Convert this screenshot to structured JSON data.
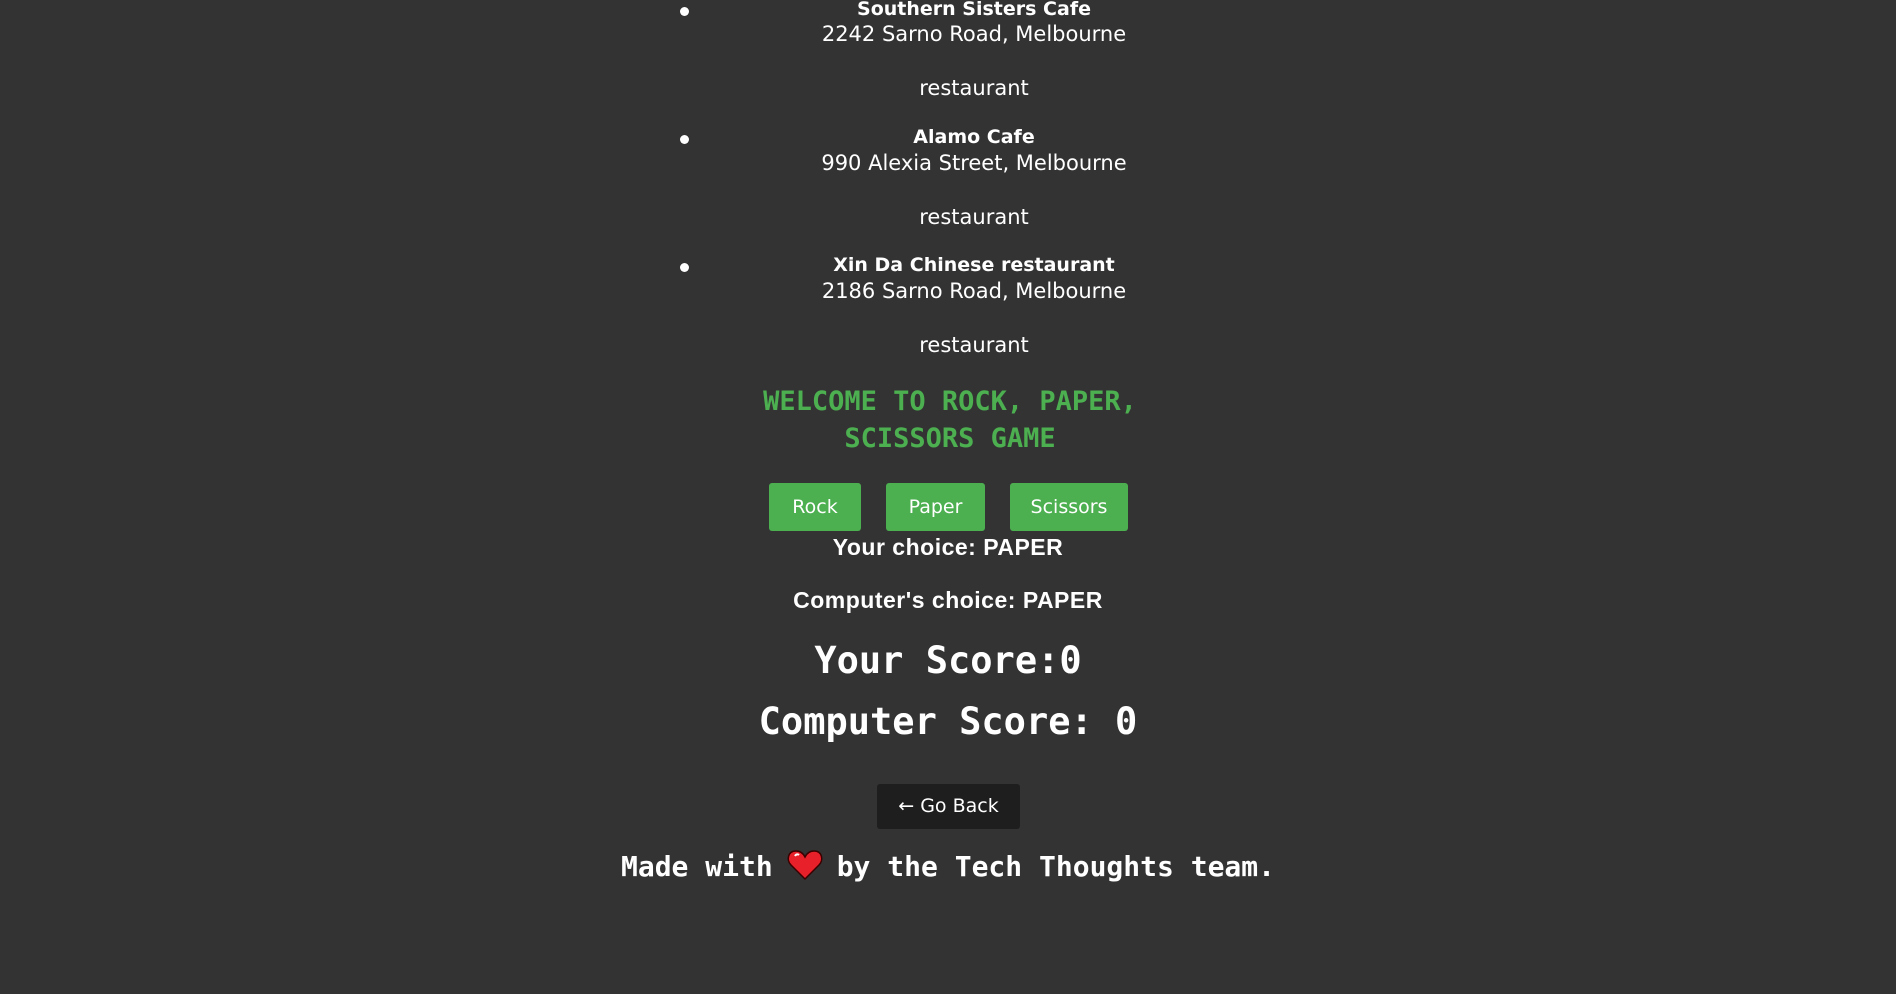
{
  "places": [
    {
      "name": "Southern Sisters Cafe",
      "address": "2242 Sarno Road, Melbourne",
      "type": "restaurant"
    },
    {
      "name": "Alamo Cafe",
      "address": "990 Alexia Street, Melbourne",
      "type": "restaurant"
    },
    {
      "name": "Xin Da Chinese restaurant",
      "address": "2186 Sarno Road, Melbourne",
      "type": "restaurant"
    }
  ],
  "game": {
    "title_line1": "WELCOME TO ROCK, PAPER,",
    "title_line2": "SCISSORS GAME",
    "buttons": {
      "rock": "Rock",
      "paper": "Paper",
      "scissors": "Scissors"
    },
    "your_choice": "Your choice: PAPER",
    "computer_choice": "Computer's choice: PAPER",
    "your_score": "Your Score:0",
    "computer_score": "Computer Score: 0"
  },
  "go_back_label": "← Go Back",
  "footer": {
    "before": "Made with",
    "after": "by the Tech Thoughts team.",
    "icon": "heart-icon"
  },
  "colors": {
    "background": "#333333",
    "accent": "#4caf50",
    "button_dark": "#1e1e1e",
    "heart": "#e8202a"
  }
}
